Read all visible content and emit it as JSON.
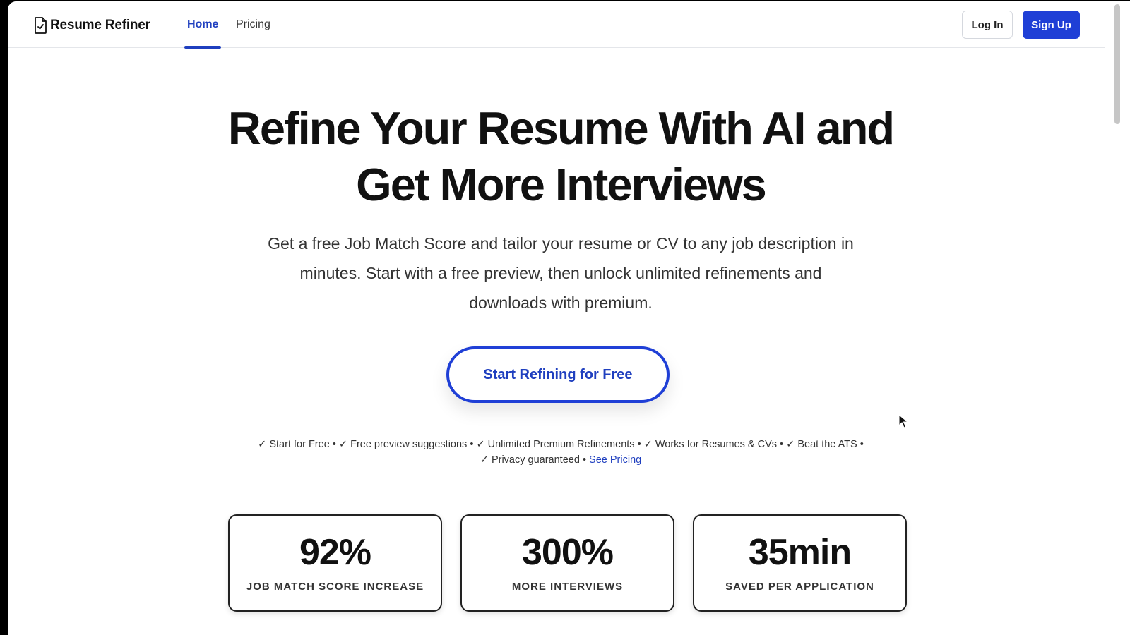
{
  "header": {
    "logo_text": "Resume Refiner",
    "nav": [
      {
        "label": "Home",
        "active": true
      },
      {
        "label": "Pricing",
        "active": false
      }
    ],
    "login_label": "Log In",
    "signup_label": "Sign Up"
  },
  "hero": {
    "title_line1": "Refine Your Resume With AI and",
    "title_line2": "Get More Interviews",
    "subtitle": "Get a free Job Match Score and tailor your resume or CV to any job description in minutes. Start with a free preview, then unlock unlimited refinements and downloads with premium.",
    "cta_label": "Start Refining for Free"
  },
  "features": {
    "items": [
      "✓ Start for Free",
      "✓ Free preview suggestions",
      "✓ Unlimited Premium Refinements",
      "✓ Works for Resumes & CVs",
      "✓ Beat the ATS",
      "✓ Privacy guaranteed"
    ],
    "separator": "•",
    "see_pricing_label": "See Pricing"
  },
  "stats": [
    {
      "value": "92%",
      "label": "JOB MATCH SCORE INCREASE"
    },
    {
      "value": "300%",
      "label": "MORE INTERVIEWS"
    },
    {
      "value": "35min",
      "label": "SAVED PER APPLICATION"
    }
  ],
  "colors": {
    "accent": "#1f3fd6",
    "accent_text": "#1f3fbf",
    "text": "#111111"
  },
  "icons": {
    "logo": "document-check-icon",
    "cursor": "mouse-pointer-icon"
  }
}
